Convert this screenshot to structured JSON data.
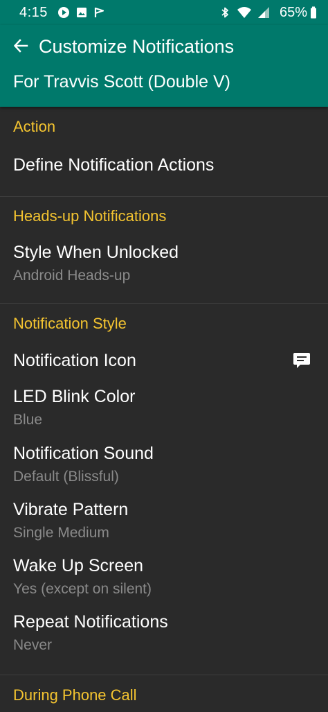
{
  "status_bar": {
    "time": "4:15",
    "battery_percent": "65%",
    "left_icons": [
      "play-circle-icon",
      "image-icon",
      "flag-icon"
    ],
    "right_icons": [
      "bluetooth-icon",
      "wifi-icon",
      "signal-icon",
      "battery-icon"
    ]
  },
  "app_bar": {
    "title": "Customize Notifications",
    "subtitle": "For Travvis Scott (Double V)",
    "color": "#00796b"
  },
  "colors": {
    "section_header": "#f4c430",
    "background": "#2a2a2a",
    "summary": "#8a8a8a"
  },
  "sections": {
    "action": {
      "header": "Action",
      "items": [
        {
          "title": "Define Notification Actions"
        }
      ]
    },
    "heads_up": {
      "header": "Heads-up Notifications",
      "items": [
        {
          "title": "Style When Unlocked",
          "summary": "Android Heads-up"
        }
      ]
    },
    "style": {
      "header": "Notification Style",
      "items": [
        {
          "title": "Notification Icon",
          "icon": "message-icon"
        },
        {
          "title": "LED Blink Color",
          "summary": "Blue"
        },
        {
          "title": "Notification Sound",
          "summary": "Default (Blissful)"
        },
        {
          "title": "Vibrate Pattern",
          "summary": "Single Medium"
        },
        {
          "title": "Wake Up Screen",
          "summary": "Yes (except on silent)"
        },
        {
          "title": "Repeat Notifications",
          "summary": "Never"
        }
      ]
    },
    "phone_call": {
      "header": "During Phone Call"
    }
  }
}
